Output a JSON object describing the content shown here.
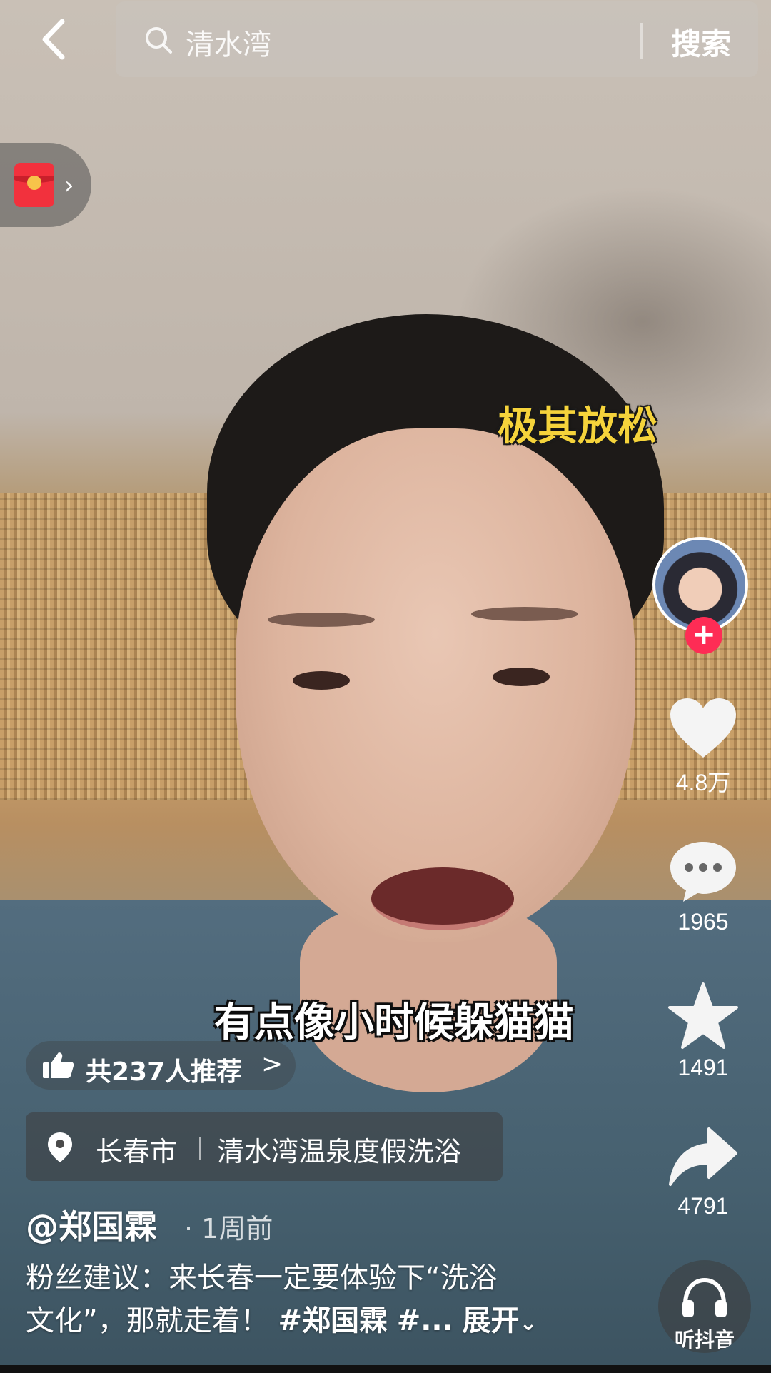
{
  "search": {
    "query": "清水湾",
    "button_label": "搜索"
  },
  "captions": {
    "top": "极其放松",
    "bottom": "有点像小时候躲猫猫"
  },
  "actions": {
    "likes": "4.8万",
    "comments": "1965",
    "favorites": "1491",
    "shares": "4791",
    "follow_symbol": "+",
    "listen_label": "听抖音"
  },
  "recommend": {
    "text": "共237人推荐",
    "arrow": ">"
  },
  "location": {
    "city": "长春市",
    "place": "清水湾温泉度假洗浴"
  },
  "post": {
    "author": "@郑国霖",
    "time": "· 1周前",
    "desc_line1": "粉丝建议：来长春一定要体验下“洗浴",
    "desc_line2": "文化”，那就走着！",
    "tag1": "#郑国霖",
    "tag2": "#...",
    "expand": "展开"
  },
  "icons": {
    "back": "back-arrow-icon",
    "search": "search-icon",
    "red_packet": "red-packet-icon",
    "like": "heart-icon",
    "comment": "comment-icon",
    "favorite": "star-icon",
    "share": "share-icon",
    "recommend": "thumbs-up-icon",
    "location": "location-pin-icon",
    "music": "headphones-icon"
  },
  "colors": {
    "accent": "#fe2c55",
    "caption_yellow": "#f5d33b",
    "red_packet": "#f2313d"
  }
}
